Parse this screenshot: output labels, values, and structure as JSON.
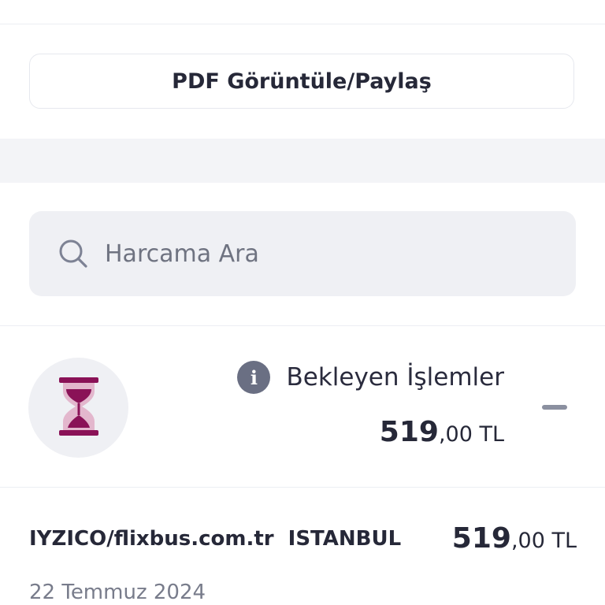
{
  "pdf_button": {
    "label": "PDF Görüntüle/Paylaş"
  },
  "search": {
    "placeholder": "Harcama Ara",
    "value": "",
    "icon": "search-icon"
  },
  "pending": {
    "icon": "hourglass-icon",
    "info_icon": "info-icon",
    "info_glyph": "i",
    "title": "Bekleyen İşlemler",
    "amount_integer": "519",
    "amount_decimal": ",00 TL",
    "collapse_icon": "minus-icon"
  },
  "transactions": [
    {
      "merchant": "IYZICO/flixbus.com.tr",
      "city": "ISTANBUL",
      "amount_integer": "519",
      "amount_decimal": ",00 TL",
      "date": "22 Temmuz 2024"
    }
  ],
  "colors": {
    "accent_hourglass": "#8a1257",
    "hourglass_fill": "#d9a6c0",
    "info_icon_bg": "#6a6f83",
    "search_bg": "#eff0f4",
    "band_bg": "#f3f4f7"
  }
}
